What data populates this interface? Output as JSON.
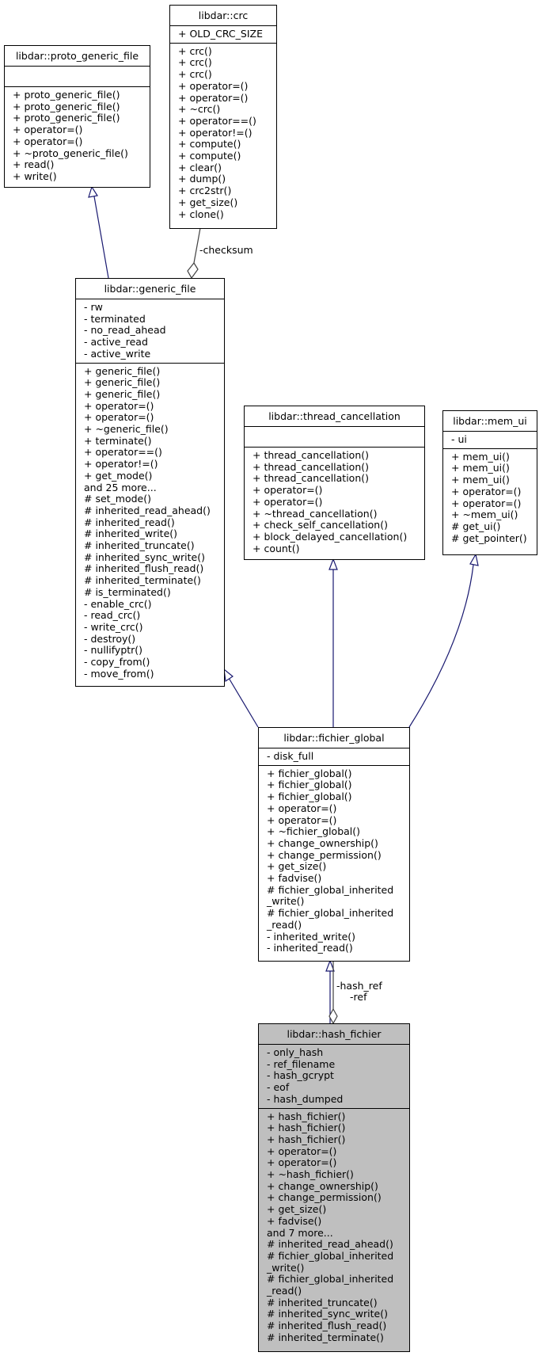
{
  "diagram": {
    "colors": {
      "inherit": "#191970",
      "aggregate": "#404040",
      "focus_fill": "#bfbfbf"
    },
    "classes": {
      "proto_generic_file": {
        "name": "libdar::proto_generic_file",
        "attributes": [],
        "methods": [
          "+ proto_generic_file()",
          "+ proto_generic_file()",
          "+ proto_generic_file()",
          "+ operator=()",
          "+ operator=()",
          "+ ~proto_generic_file()",
          "+ read()",
          "+ write()"
        ]
      },
      "crc": {
        "name": "libdar::crc",
        "attributes": [
          "+ OLD_CRC_SIZE"
        ],
        "methods": [
          "+ crc()",
          "+ crc()",
          "+ crc()",
          "+ operator=()",
          "+ operator=()",
          "+ ~crc()",
          "+ operator==()",
          "+ operator!=()",
          "+ compute()",
          "+ compute()",
          "+ clear()",
          "+ dump()",
          "+ crc2str()",
          "+ get_size()",
          "+ clone()"
        ]
      },
      "generic_file": {
        "name": "libdar::generic_file",
        "attributes": [
          "- rw",
          "- terminated",
          "- no_read_ahead",
          "- active_read",
          "- active_write"
        ],
        "methods": [
          "+ generic_file()",
          "+ generic_file()",
          "+ generic_file()",
          "+ operator=()",
          "+ operator=()",
          "+ ~generic_file()",
          "+ terminate()",
          "+ operator==()",
          "+ operator!=()",
          "+ get_mode()",
          "and 25 more...",
          "# set_mode()",
          "# inherited_read_ahead()",
          "# inherited_read()",
          "# inherited_write()",
          "# inherited_truncate()",
          "# inherited_sync_write()",
          "# inherited_flush_read()",
          "# inherited_terminate()",
          "# is_terminated()",
          "- enable_crc()",
          "- read_crc()",
          "- write_crc()",
          "- destroy()",
          "- nullifyptr()",
          "- copy_from()",
          "- move_from()"
        ]
      },
      "thread_cancellation": {
        "name": "libdar::thread_cancellation",
        "attributes": [],
        "methods": [
          "+ thread_cancellation()",
          "+ thread_cancellation()",
          "+ thread_cancellation()",
          "+ operator=()",
          "+ operator=()",
          "+ ~thread_cancellation()",
          "+ check_self_cancellation()",
          "+ block_delayed_cancellation()",
          "+ count()"
        ]
      },
      "mem_ui": {
        "name": "libdar::mem_ui",
        "attributes": [
          "- ui"
        ],
        "methods": [
          "+ mem_ui()",
          "+ mem_ui()",
          "+ mem_ui()",
          "+ operator=()",
          "+ operator=()",
          "+ ~mem_ui()",
          "# get_ui()",
          "# get_pointer()"
        ]
      },
      "fichier_global": {
        "name": "libdar::fichier_global",
        "attributes": [
          "- disk_full"
        ],
        "methods": [
          "+ fichier_global()",
          "+ fichier_global()",
          "+ fichier_global()",
          "+ operator=()",
          "+ operator=()",
          "+ ~fichier_global()",
          "+ change_ownership()",
          "+ change_permission()",
          "+ get_size()",
          "+ fadvise()",
          "# fichier_global_inherited",
          "_write()",
          "# fichier_global_inherited",
          "_read()",
          "- inherited_write()",
          "- inherited_read()"
        ]
      },
      "hash_fichier": {
        "name": "libdar::hash_fichier",
        "attributes": [
          "- only_hash",
          "- ref_filename",
          "- hash_gcrypt",
          "- eof",
          "- hash_dumped"
        ],
        "methods": [
          "+ hash_fichier()",
          "+ hash_fichier()",
          "+ hash_fichier()",
          "+ operator=()",
          "+ operator=()",
          "+ ~hash_fichier()",
          "+ change_ownership()",
          "+ change_permission()",
          "+ get_size()",
          "+ fadvise()",
          "and 7 more...",
          "# inherited_read_ahead()",
          "# fichier_global_inherited",
          "_write()",
          "# fichier_global_inherited",
          "_read()",
          "# inherited_truncate()",
          "# inherited_sync_write()",
          "# inherited_flush_read()",
          "# inherited_terminate()"
        ]
      }
    },
    "relations": [
      {
        "type": "inheritance",
        "from": "generic_file",
        "to": "proto_generic_file"
      },
      {
        "type": "aggregation",
        "from": "crc",
        "to": "generic_file",
        "label": "-checksum"
      },
      {
        "type": "inheritance",
        "from": "fichier_global",
        "to": "generic_file"
      },
      {
        "type": "inheritance",
        "from": "fichier_global",
        "to": "thread_cancellation"
      },
      {
        "type": "inheritance",
        "from": "fichier_global",
        "to": "mem_ui"
      },
      {
        "type": "inheritance",
        "from": "hash_fichier",
        "to": "fichier_global"
      },
      {
        "type": "aggregation",
        "from": "fichier_global",
        "to": "hash_fichier",
        "label": "-hash_ref\n-ref",
        "label_lines": [
          "-hash_ref",
          "-ref"
        ]
      }
    ]
  }
}
